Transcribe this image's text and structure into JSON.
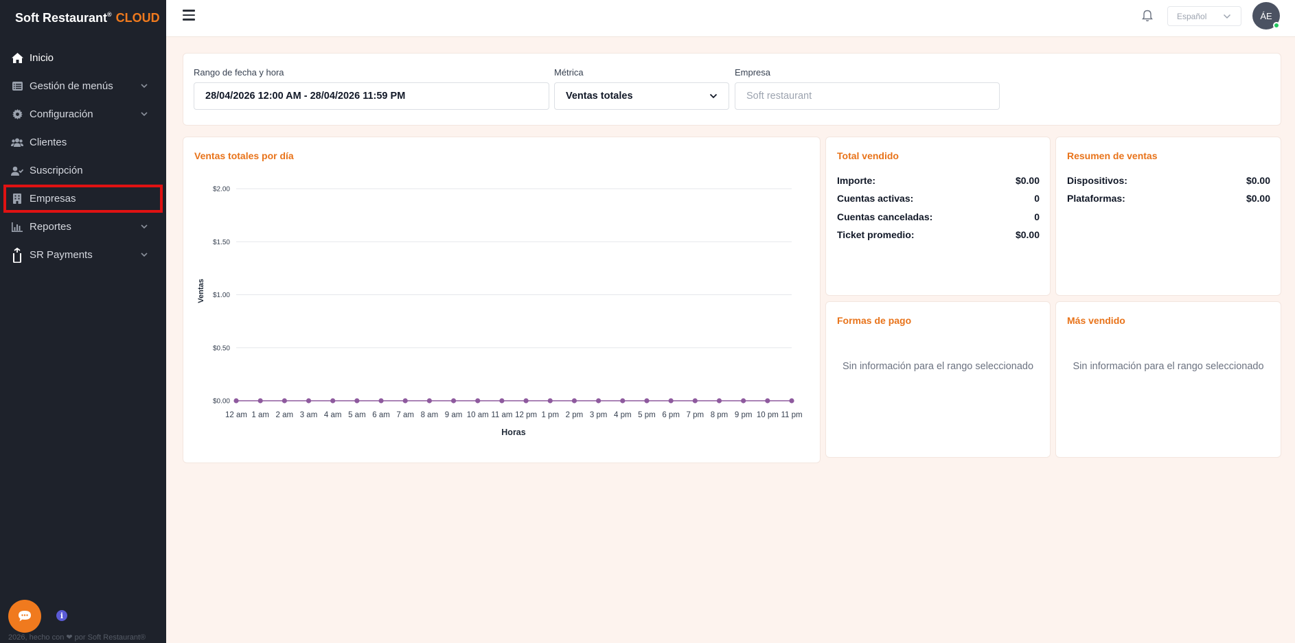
{
  "brand": {
    "name": "Soft Restaurant",
    "reg": "®",
    "suffix": "CLOUD"
  },
  "sidebar": {
    "items": [
      {
        "label": "Inicio",
        "icon": "home-icon"
      },
      {
        "label": "Gestión de menús",
        "icon": "menu-list-icon",
        "expandable": true
      },
      {
        "label": "Configuración",
        "icon": "gear-icon",
        "expandable": true
      },
      {
        "label": "Clientes",
        "icon": "users-icon"
      },
      {
        "label": "Suscripción",
        "icon": "user-check-icon"
      },
      {
        "label": "Empresas",
        "icon": "building-icon",
        "highlighted": true
      },
      {
        "label": "Reportes",
        "icon": "bar-chart-icon",
        "expandable": true
      },
      {
        "label": "SR Payments",
        "icon": "sr-payments-icon",
        "expandable": true
      }
    ],
    "footer": "2026, hecho con ❤ por Soft Restaurant®",
    "info_label": "i"
  },
  "topbar": {
    "language": "Español",
    "avatar_initials": "ÁE"
  },
  "filters": {
    "date_range": {
      "label": "Rango de fecha y hora",
      "value": "28/04/2026 12:00 AM - 28/04/2026 11:59 PM"
    },
    "metric": {
      "label": "Métrica",
      "value": "Ventas totales"
    },
    "company": {
      "label": "Empresa",
      "placeholder": "Soft restaurant"
    }
  },
  "chart_data": {
    "type": "line",
    "title": "Ventas totales por día",
    "xlabel": "Horas",
    "ylabel": "Ventas",
    "categories": [
      "12 am",
      "1 am",
      "2 am",
      "3 am",
      "4 am",
      "5 am",
      "6 am",
      "7 am",
      "8 am",
      "9 am",
      "10 am",
      "11 am",
      "12 pm",
      "1 pm",
      "2 pm",
      "3 pm",
      "4 pm",
      "5 pm",
      "6 pm",
      "7 pm",
      "8 pm",
      "9 pm",
      "10 pm",
      "11 pm"
    ],
    "values": [
      0,
      0,
      0,
      0,
      0,
      0,
      0,
      0,
      0,
      0,
      0,
      0,
      0,
      0,
      0,
      0,
      0,
      0,
      0,
      0,
      0,
      0,
      0,
      0
    ],
    "yticks": [
      "$0.00",
      "$0.50",
      "$1.00",
      "$1.50",
      "$2.00"
    ],
    "ylim": [
      0,
      2
    ],
    "grid": true,
    "series_color": "#8e5a9e"
  },
  "total_vendido": {
    "title": "Total vendido",
    "rows": [
      {
        "label": "Importe:",
        "value": "$0.00"
      },
      {
        "label": "Cuentas activas:",
        "value": "0"
      },
      {
        "label": "Cuentas canceladas:",
        "value": "0"
      },
      {
        "label": "Ticket promedio:",
        "value": "$0.00"
      }
    ]
  },
  "resumen_ventas": {
    "title": "Resumen de ventas",
    "rows": [
      {
        "label": "Dispositivos:",
        "value": "$0.00"
      },
      {
        "label": "Plataformas:",
        "value": "$0.00"
      }
    ]
  },
  "formas_pago": {
    "title": "Formas de pago",
    "empty": "Sin información para el rango seleccionado"
  },
  "mas_vendido": {
    "title": "Más vendido",
    "empty": "Sin información para el rango seleccionado"
  },
  "colors": {
    "accent": "#f07a1e",
    "sidebar_bg": "#1e222b",
    "page_bg": "#fdf3ee",
    "highlight": "#e01212"
  }
}
